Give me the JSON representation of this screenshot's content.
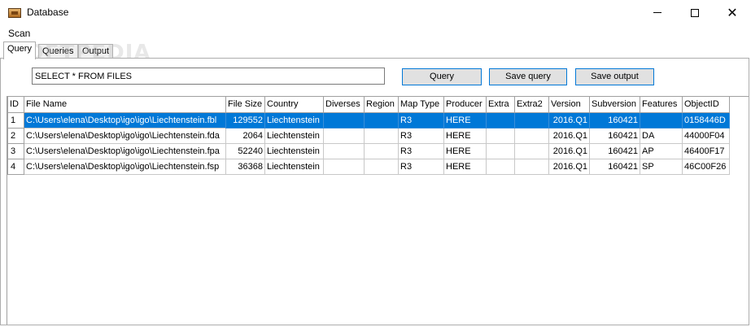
{
  "window": {
    "title": "Database",
    "icon": "database-app-icon",
    "controls": {
      "minimize": "minimize-icon",
      "maximize": "maximize-icon",
      "close": "close-icon"
    }
  },
  "menu": {
    "items": [
      {
        "label": "Scan"
      }
    ]
  },
  "tabs": [
    {
      "label": "Query",
      "active": true
    },
    {
      "label": "Queries",
      "active": false
    },
    {
      "label": "Output",
      "active": false
    }
  ],
  "query": {
    "text": "SELECT * FROM FILES",
    "query_button": "Query",
    "save_query_button": "Save query",
    "save_output_button": "Save output"
  },
  "table": {
    "columns": [
      "ID",
      "File Name",
      "File Size",
      "Country",
      "Diverses",
      "Region",
      "Map Type",
      "Producer",
      "Extra",
      "Extra2",
      "Version",
      "Subversion",
      "Features",
      "ObjectID"
    ],
    "rows": [
      [
        "1",
        "C:\\Users\\elena\\Desktop\\igo\\igo\\Liechtenstein.fbl",
        "129552",
        "Liechtenstein",
        "",
        "",
        "R3",
        "HERE",
        "",
        "",
        "2016.Q1",
        "160421",
        "",
        "0158446D"
      ],
      [
        "2",
        "C:\\Users\\elena\\Desktop\\igo\\igo\\Liechtenstein.fda",
        "2064",
        "Liechtenstein",
        "",
        "",
        "R3",
        "HERE",
        "",
        "",
        "2016.Q1",
        "160421",
        "DA",
        "44000F04"
      ],
      [
        "3",
        "C:\\Users\\elena\\Desktop\\igo\\igo\\Liechtenstein.fpa",
        "52240",
        "Liechtenstein",
        "",
        "",
        "R3",
        "HERE",
        "",
        "",
        "2016.Q1",
        "160421",
        "AP",
        "46400F17"
      ],
      [
        "4",
        "C:\\Users\\elena\\Desktop\\igo\\igo\\Liechtenstein.fsp",
        "36368",
        "Liechtenstein",
        "",
        "",
        "R3",
        "HERE",
        "",
        "",
        "2016.Q1",
        "160421",
        "SP",
        "46C00F26"
      ]
    ],
    "selected_row": 0
  },
  "colors": {
    "selection": "#0078d7",
    "button_border": "#0078d7",
    "button_bg": "#e1e1e1"
  },
  "watermark": "SOFTPEDIA"
}
